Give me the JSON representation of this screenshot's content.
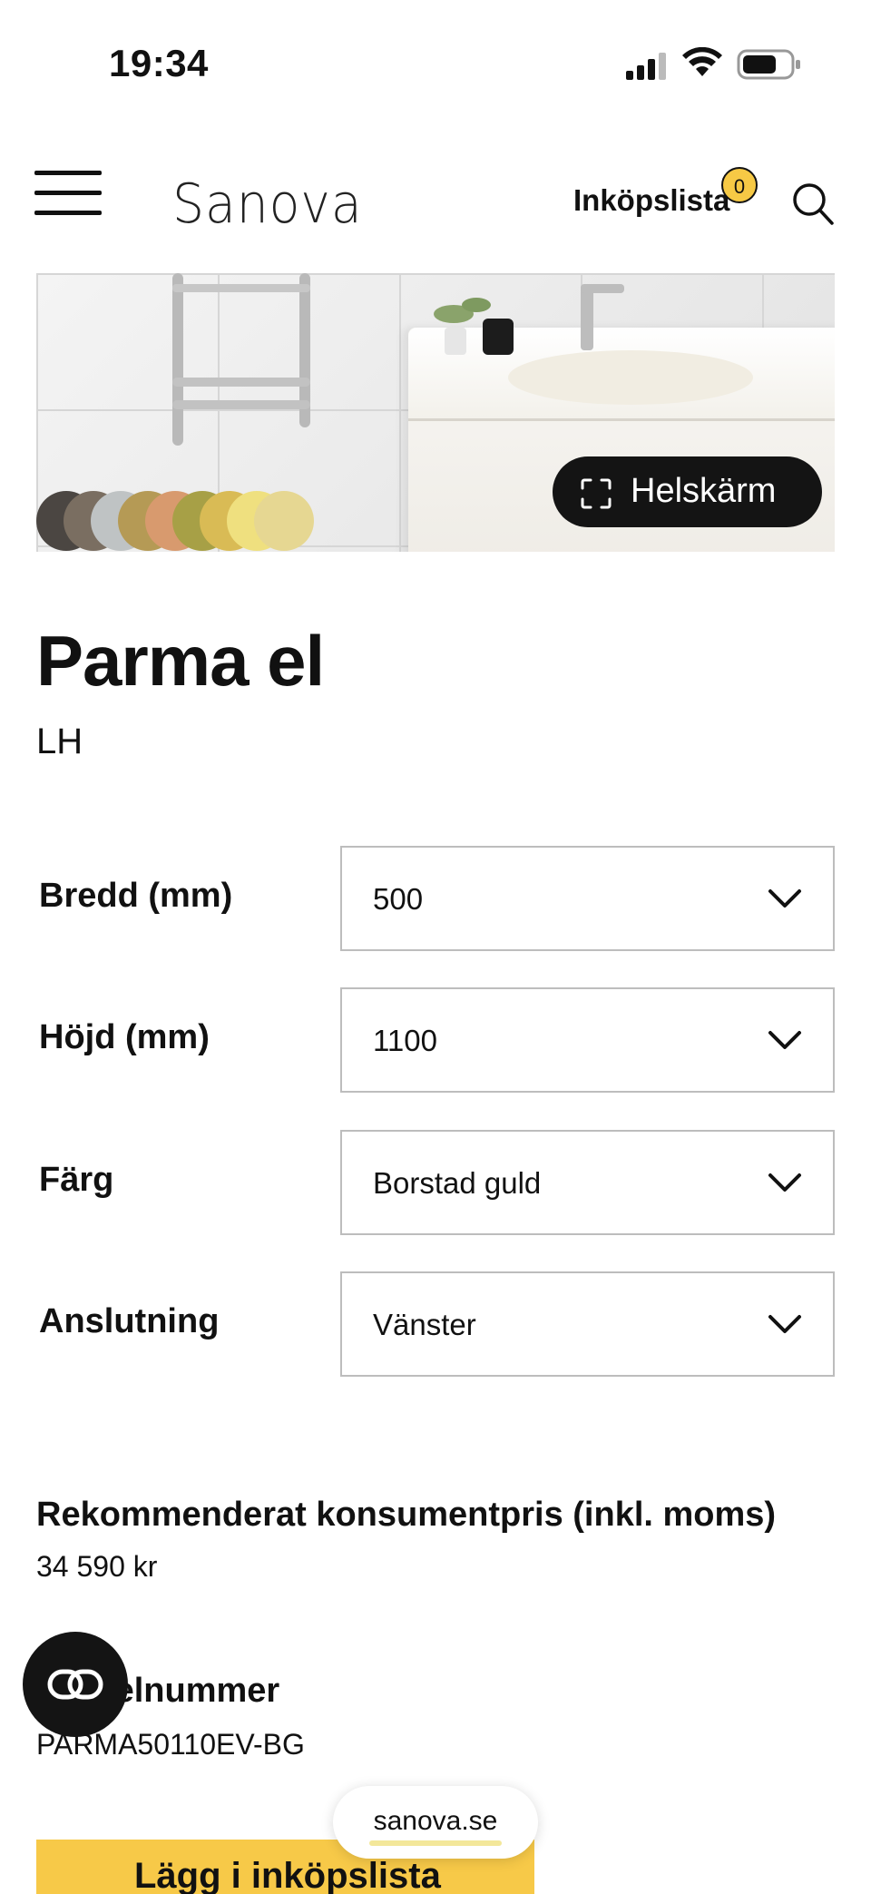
{
  "status_bar": {
    "time": "19:34"
  },
  "header": {
    "logo": "Sanova",
    "shopping_list_label": "Inköpslista",
    "shopping_list_count": "0",
    "icons": [
      "menu-icon",
      "search-icon"
    ]
  },
  "hero": {
    "fullscreen_label": "Helskärm",
    "swatch_colors": [
      "#4b4642",
      "#7a6e61",
      "#bfc3c4",
      "#b59a55",
      "#d89a6e",
      "#a7a046",
      "#d9bb55",
      "#efe07f",
      "#e6d792"
    ]
  },
  "product": {
    "title": "Parma el",
    "subtitle": "LH"
  },
  "options": [
    {
      "label": "Bredd (mm)",
      "value": "500"
    },
    {
      "label": "Höjd (mm)",
      "value": "1100"
    },
    {
      "label": "Färg",
      "value": "Borstad guld"
    },
    {
      "label": "Anslutning",
      "value": "Vänster"
    }
  ],
  "price": {
    "label": "Rekommenderat konsumentpris (inkl. moms)",
    "value": "34 590 kr"
  },
  "article": {
    "label": "Artikelnummer",
    "value": "PARMA50110EV-BG"
  },
  "browser": {
    "url": "sanova.se"
  },
  "cta": {
    "label": "Lägg i inköpslista"
  },
  "colors": {
    "accent": "#f7c948",
    "dark": "#141414"
  }
}
